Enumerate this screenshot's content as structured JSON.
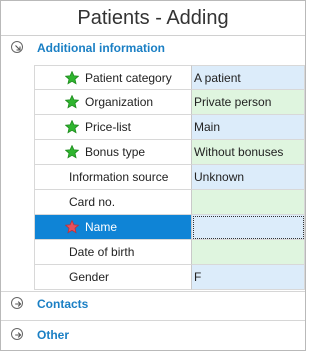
{
  "window": {
    "title": "Patients - Adding"
  },
  "sections": {
    "additional": {
      "label": "Additional information",
      "icon": "chevron-collapse-icon"
    },
    "contacts": {
      "label": "Contacts",
      "icon": "chevron-expand-icon"
    },
    "other": {
      "label": "Other",
      "icon": "chevron-expand-icon"
    }
  },
  "fields": [
    {
      "label": "Patient category",
      "value": "A patient",
      "star": "green",
      "bg": "blue"
    },
    {
      "label": "Organization",
      "value": "Private person",
      "star": "green",
      "bg": "green"
    },
    {
      "label": "Price-list",
      "value": "Main",
      "star": "green",
      "bg": "blue"
    },
    {
      "label": "Bonus type",
      "value": "Without bonuses",
      "star": "green",
      "bg": "green"
    },
    {
      "label": "Information source",
      "value": "Unknown",
      "star": "none",
      "bg": "blue"
    },
    {
      "label": "Card no.",
      "value": "",
      "star": "none",
      "bg": "green"
    },
    {
      "label": "Name",
      "value": "",
      "star": "red",
      "bg": "blue",
      "selected": true
    },
    {
      "label": "Date of birth",
      "value": "",
      "star": "none",
      "bg": "green"
    },
    {
      "label": "Gender",
      "value": "F",
      "star": "none",
      "bg": "blue"
    }
  ],
  "colors": {
    "accent": "#1a7fc4",
    "selection": "#0f84d6",
    "value_blue": "#dcecfa",
    "value_green": "#dff5df",
    "star_green": "#2fb52f",
    "star_red": "#e8505b"
  }
}
